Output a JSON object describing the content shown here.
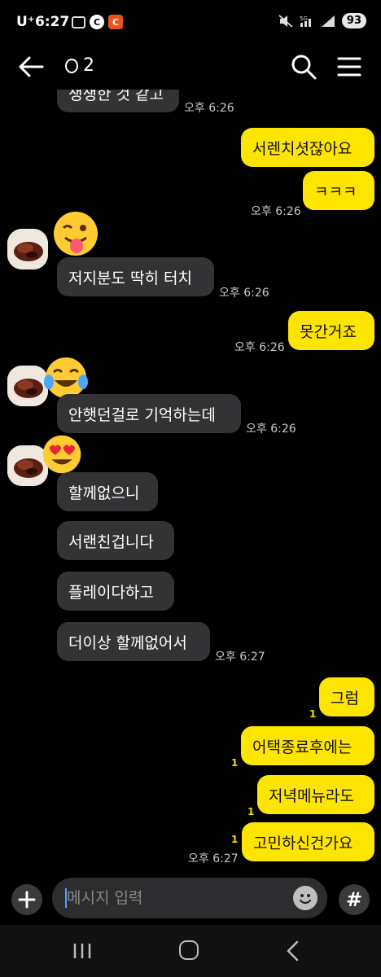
{
  "status": {
    "carrier": "U⁺",
    "time": "6:27",
    "icon_c": "C",
    "network": "5G",
    "battery": "93"
  },
  "header": {
    "title": "2"
  },
  "messages": [
    {
      "side": "in",
      "text": "생생한 것 같고",
      "time": "오후 6:26"
    },
    {
      "side": "out",
      "text": "서렌치셧잖아요"
    },
    {
      "side": "out",
      "text": "ㅋㅋㅋ",
      "time": "오후 6:26"
    },
    {
      "side": "in",
      "text": "저지분도 딱히 터치",
      "time": "오후 6:26",
      "reaction": "tongue-wink-emoji"
    },
    {
      "side": "out",
      "text": "못간거죠",
      "time": "오후 6:26"
    },
    {
      "side": "in",
      "text": "안햇던걸로 기억하는데",
      "time": "오후 6:26",
      "reaction": "tears-of-joy-emoji"
    },
    {
      "side": "in",
      "text": "할께없으니",
      "reaction": "heart-eyes-emoji"
    },
    {
      "side": "in",
      "text": "서랜친겁니다"
    },
    {
      "side": "in",
      "text": "플레이다하고"
    },
    {
      "side": "in",
      "text": "더이상 할께없어서",
      "time": "오후 6:27"
    },
    {
      "side": "out",
      "text": "그럼",
      "unread": "1"
    },
    {
      "side": "out",
      "text": "어택종료후에는",
      "unread": "1"
    },
    {
      "side": "out",
      "text": "저녁메뉴라도",
      "unread": "1"
    },
    {
      "side": "out",
      "text": "고민하신건가요",
      "unread": "1",
      "time": "오후 6:27"
    }
  ],
  "input": {
    "placeholder": "메시지 입력",
    "hash_label": "#"
  },
  "colors": {
    "outgoing_bubble": "#fee500",
    "incoming_bubble": "#333336",
    "background": "#000000",
    "unread": "#f5d800"
  }
}
